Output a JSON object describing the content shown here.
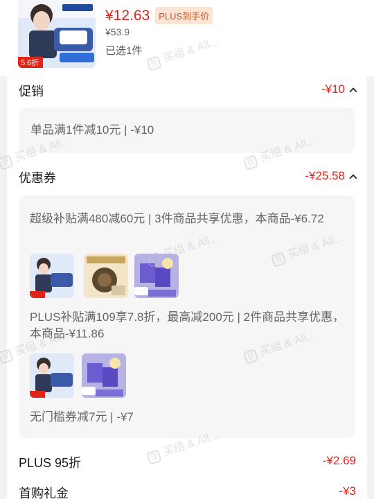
{
  "product": {
    "price": "¥12.63",
    "plus_badge": "PLUS到手价",
    "original_price": "¥53.9",
    "selected": "已选1件",
    "thumb_tag": "5.6折"
  },
  "promotion": {
    "title": "促销",
    "amount": "-¥10",
    "detail": "单品满1件减10元 | -¥10"
  },
  "coupons": {
    "title": "优惠券",
    "amount": "-¥25.58",
    "items": [
      {
        "text": "超级补贴满480减60元 | 3件商品共享优惠，本商品-¥6.72"
      },
      {
        "text": "PLUS补贴满109享7.8折，最高减200元 | 2件商品共享优惠，本商品-¥11.86"
      },
      {
        "text": "无门槛券减7元 | -¥7"
      }
    ]
  },
  "plus_discount": {
    "title": "PLUS 95折",
    "amount": "-¥2.69"
  },
  "first_purchase": {
    "title": "首购礼金",
    "amount": "-¥3"
  },
  "watermark": {
    "text": "买组 & All...",
    "badge": "豆"
  },
  "colors": {
    "accent": "#e2231a",
    "card_bg": "#f6f6f6",
    "plus_tag_bg": "#fbe3d6"
  }
}
